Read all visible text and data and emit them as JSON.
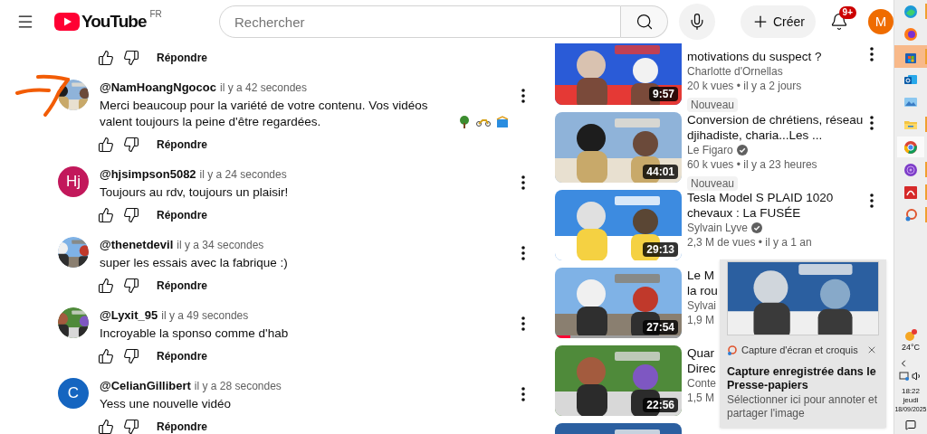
{
  "header": {
    "logo": "YouTube",
    "region": "FR",
    "search": {
      "placeholder": "Rechercher"
    },
    "create_label": "Créer",
    "notifications_badge": "9+",
    "account_initial": "M"
  },
  "top_actions": {
    "reply": "Répondre"
  },
  "comments": [
    {
      "author": "@NamHoangNgococ",
      "time": "il y a 42 secondes",
      "text": "Merci beaucoup pour la variété de votre contenu. Vos vidéos valent toujours la peine d'être regardées.",
      "emoji_icons": true,
      "reply": "Répondre"
    },
    {
      "author": "@hjsimpson5082",
      "time": "il y a 24 secondes",
      "text": "Toujours au rdv, toujours un plaisir!",
      "emoji_icons": false,
      "avatar": {
        "kind": "letter",
        "letter": "Hj",
        "color": "#c2185b"
      },
      "reply": "Répondre"
    },
    {
      "author": "@thenetdevil",
      "time": "il y a 34 secondes",
      "text": "super les essais avec la fabrique :)",
      "emoji_icons": false,
      "reply": "Répondre"
    },
    {
      "author": "@Lyxit_95",
      "time": "il y a 49 secondes",
      "text": "Incroyable la sponso comme d'hab",
      "emoji_icons": false,
      "reply": "Répondre"
    },
    {
      "author": "@CelianGillibert",
      "time": "il y a 28 secondes",
      "text": "Yess une nouvelle vidéo",
      "emoji_icons": false,
      "avatar": {
        "kind": "letter",
        "letter": "C",
        "color": "#1565c0"
      },
      "reply": "Répondre"
    }
  ],
  "videos": [
    {
      "title_lines": [
        "motivations du suspect ?"
      ],
      "channel": "Charlotte d'Ornellas",
      "verified": false,
      "views": "20 k vues • il y a 2 jours",
      "badge": "Nouveau",
      "duration": "9:57",
      "more_button": true
    },
    {
      "title_lines": [
        "Conversion de chrétiens, réseau",
        "djihadiste, charia...Les ..."
      ],
      "channel": "Le Figaro",
      "verified": true,
      "views": "60 k vues • il y a 23 heures",
      "badge": "Nouveau",
      "duration": "44:01",
      "more_button": true
    },
    {
      "title_lines": [
        "Tesla Model S PLAID 1020",
        "chevaux : La FUSÉE"
      ],
      "channel": "Sylvain Lyve",
      "verified": true,
      "views": "2,3 M de vues • il y a 1 an",
      "duration": "29:13",
      "more_button": true
    },
    {
      "title_lines": [
        "Le M",
        "la rou"
      ],
      "channel": "Sylvai",
      "verified": false,
      "views": "1,9 M",
      "duration": "27:54",
      "level": 0.12,
      "more_button": false
    },
    {
      "title_lines": [
        "Quar",
        "Direc"
      ],
      "channel": "Conte",
      "verified": false,
      "views": "1,5 M",
      "duration": "22:56",
      "more_button": false
    }
  ],
  "toast": {
    "app": "Capture d'écran et croquis",
    "title": "Capture enregistrée dans le Presse-papiers",
    "body": "Sélectionner ici pour annoter et partager l'image"
  },
  "taskbar": {
    "apps": [
      {
        "running": true,
        "selected": false,
        "highlighted": false
      },
      {
        "running": false,
        "selected": false,
        "highlighted": false
      },
      {
        "running": true,
        "selected": false,
        "highlighted": true
      },
      {
        "running": false,
        "selected": false,
        "highlighted": false
      },
      {
        "running": false,
        "selected": false,
        "highlighted": false
      },
      {
        "running": true,
        "selected": false,
        "highlighted": false
      },
      {
        "running": false,
        "selected": true,
        "highlighted": false
      },
      {
        "running": true,
        "selected": false,
        "highlighted": false
      },
      {
        "running": true,
        "selected": false,
        "highlighted": false
      },
      {
        "running": true,
        "selected": false,
        "highlighted": false
      }
    ],
    "weather": "24°C",
    "time": "18:22",
    "day": "jeudi",
    "date": "18/09/2025"
  }
}
